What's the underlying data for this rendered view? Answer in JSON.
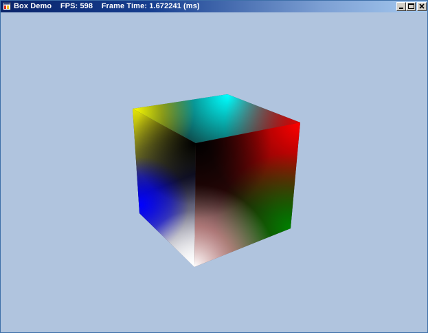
{
  "window": {
    "title": "Box Demo",
    "fps_label": "FPS:",
    "fps_value": "598",
    "frame_time_label": "Frame Time:",
    "frame_time_value": "1.672241",
    "frame_time_unit": "(ms)"
  },
  "icons": {
    "app": "app-icon",
    "minimize": "minimize-icon",
    "maximize": "maximize-icon",
    "close": "close-icon"
  },
  "colors": {
    "background": "#b0c4de",
    "titlebar_start": "#0a246a",
    "titlebar_end": "#a6caf0",
    "cube_yellow": "#ffff00",
    "cube_cyan": "#00ffff",
    "cube_red": "#ff0000",
    "cube_green": "#008000",
    "cube_blue": "#0000ff",
    "cube_white": "#ffffff",
    "cube_black": "#000000"
  }
}
